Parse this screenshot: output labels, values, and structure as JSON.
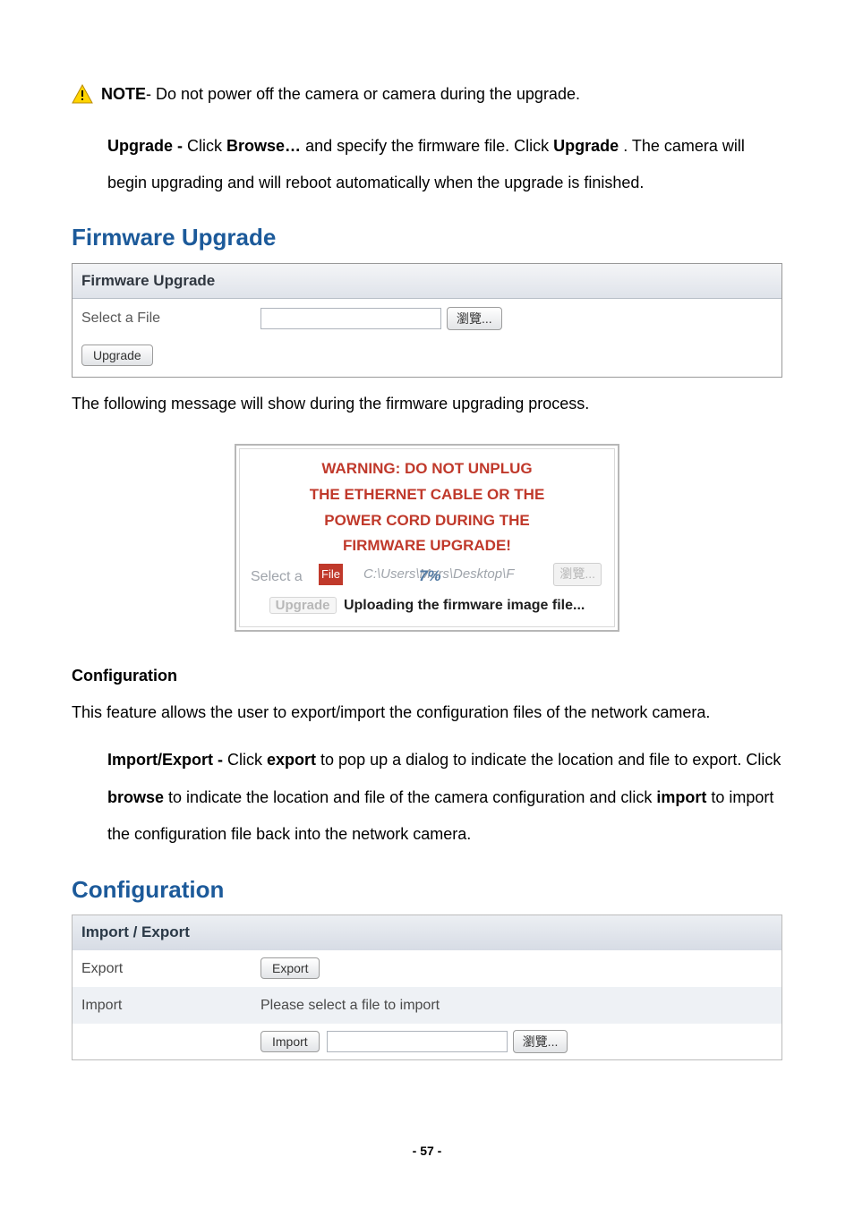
{
  "note": {
    "label": "NOTE",
    "text": " - Do not power off the camera or camera during the upgrade."
  },
  "upgrade_para": {
    "lead": "Upgrade - ",
    "t1": "Click ",
    "browse": "Browse…",
    "t2": " and specify the firmware file. Click ",
    "upg": "Upgrade",
    "t3": ". The camera will begin upgrading and will reboot automatically when the upgrade is finished."
  },
  "firmware": {
    "heading": "Firmware Upgrade",
    "sub": "Firmware Upgrade",
    "select_label": "Select a File",
    "browse_btn": "瀏覽...",
    "upgrade_btn": "Upgrade"
  },
  "following_msg": "The following message will show during the firmware upgrading process.",
  "warn_box": {
    "l1": "WARNING: DO NOT UNPLUG",
    "l2": "THE ETHERNET CABLE OR THE",
    "l3": "POWER CORD DURING THE",
    "l4": "FIRMWARE UPGRADE!",
    "ghost_select": "Select a",
    "ghost_path": "C:\\Users\\Mars\\Desktop\\F",
    "progress": "7%",
    "overlay_red": "File",
    "ghost_browse": "瀏覽...",
    "ghost_upgrade": "Upgrade",
    "uploading": "Uploading the firmware image file..."
  },
  "config_section": {
    "h": "Configuration",
    "desc": "This feature allows the user to export/import the configuration files of the network camera.",
    "para_lead": "Import/Export - ",
    "t1": "Click ",
    "exp": "export",
    "t2": " to pop up a dialog to indicate the location and file to export. Click ",
    "brw": "browse",
    "t3": " to indicate the location and file of the camera configuration and click ",
    "imp": "import",
    "t4": " to import the configuration file back into the network camera."
  },
  "config_panel": {
    "heading": "Configuration",
    "sub": "Import / Export",
    "export_label": "Export",
    "export_btn": "Export",
    "import_label": "Import",
    "import_msg": "Please select a file to import",
    "import_btn": "Import",
    "browse_btn": "瀏覽..."
  },
  "page_num": "- 57 -"
}
